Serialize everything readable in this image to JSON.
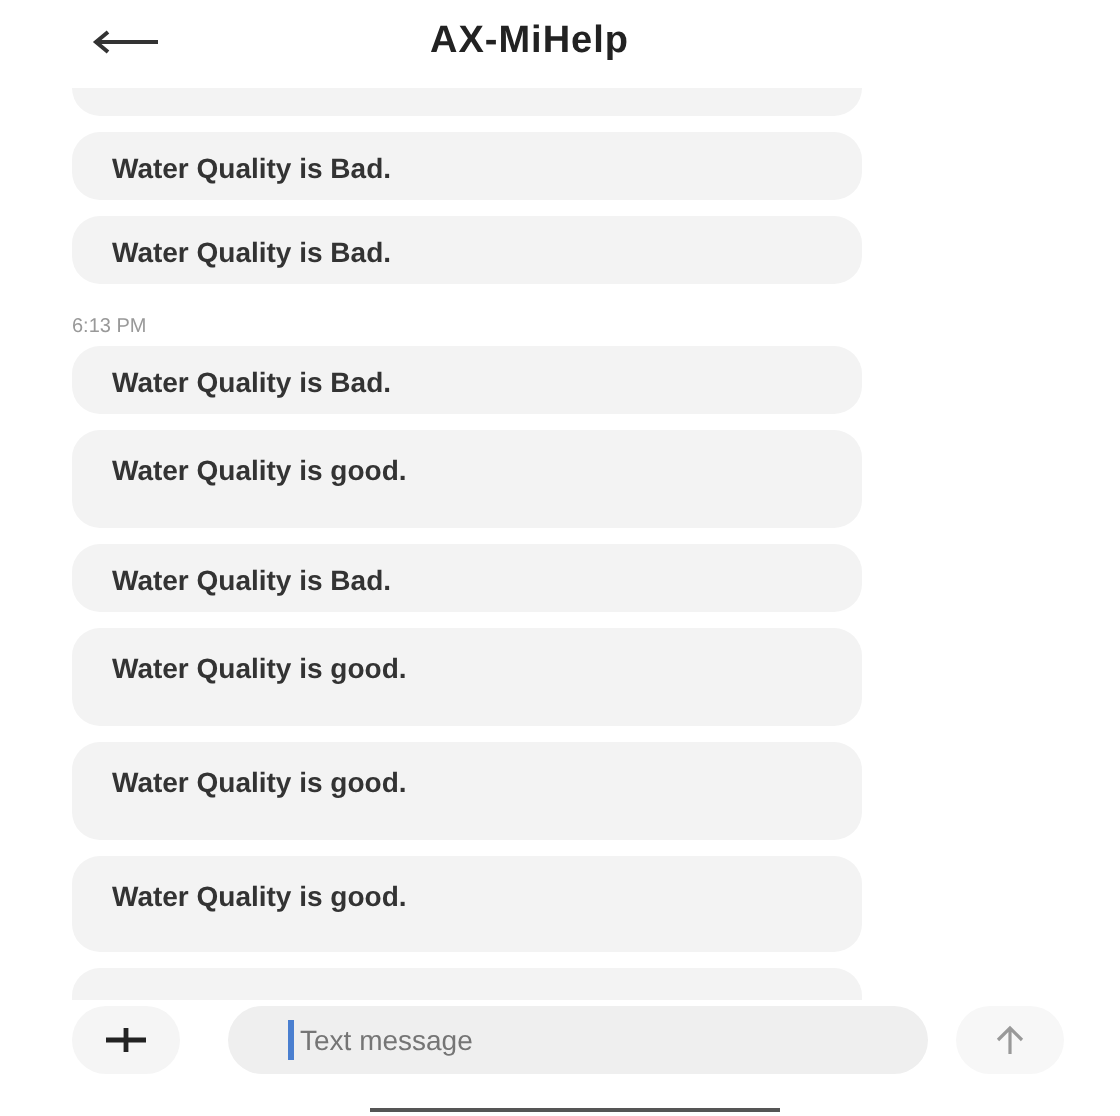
{
  "header": {
    "title": "AX-MiHelp"
  },
  "messages": [
    {
      "kind": "partial"
    },
    {
      "kind": "message",
      "text": "Water Quality is Bad.",
      "tall": false
    },
    {
      "kind": "message",
      "text": "Water Quality is Bad.",
      "tall": false
    },
    {
      "kind": "time",
      "text": "6:13 PM"
    },
    {
      "kind": "message",
      "text": "Water Quality is Bad.",
      "tall": false
    },
    {
      "kind": "message",
      "text": "Water Quality is good.",
      "tall": true
    },
    {
      "kind": "message",
      "text": "Water Quality is Bad.",
      "tall": false
    },
    {
      "kind": "message",
      "text": "Water Quality is good.",
      "tall": true
    },
    {
      "kind": "message",
      "text": "Water Quality is good.",
      "tall": true
    },
    {
      "kind": "message",
      "text": "Water Quality is good.",
      "tall": true
    },
    {
      "kind": "partial"
    }
  ],
  "composer": {
    "placeholder": "Text message"
  }
}
